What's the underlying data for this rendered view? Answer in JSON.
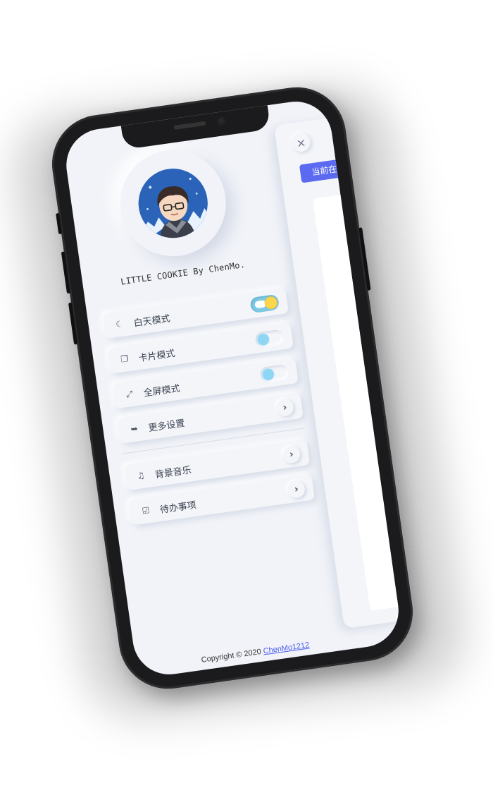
{
  "profile": {
    "tagline": "LITTLE COOKIE By ChenMo."
  },
  "menu": {
    "items": [
      {
        "label": "白天模式",
        "icon": "moon-icon",
        "control": "toggle",
        "on": true
      },
      {
        "label": "卡片模式",
        "icon": "copy-icon",
        "control": "toggle",
        "on": false
      },
      {
        "label": "全屏模式",
        "icon": "expand-icon",
        "control": "toggle",
        "on": false
      },
      {
        "label": "更多设置",
        "icon": "sign-out-icon",
        "control": "arrow"
      }
    ],
    "extras": [
      {
        "label": "背景音乐",
        "icon": "music-icon",
        "control": "arrow"
      },
      {
        "label": "待办事项",
        "icon": "checkbox-icon",
        "control": "arrow"
      }
    ]
  },
  "panel": {
    "tag": "当前在",
    "close_icon": "close-icon"
  },
  "footer": {
    "copyright_prefix": "Copyright © 2020 ",
    "author_link": "ChenMo1212"
  },
  "colors": {
    "background": "#f1f3f8",
    "accent": "#5b6af0",
    "toggle_on": "#7fcbe6",
    "knob": "#8fd6f5",
    "sun": "#ffd54a"
  }
}
